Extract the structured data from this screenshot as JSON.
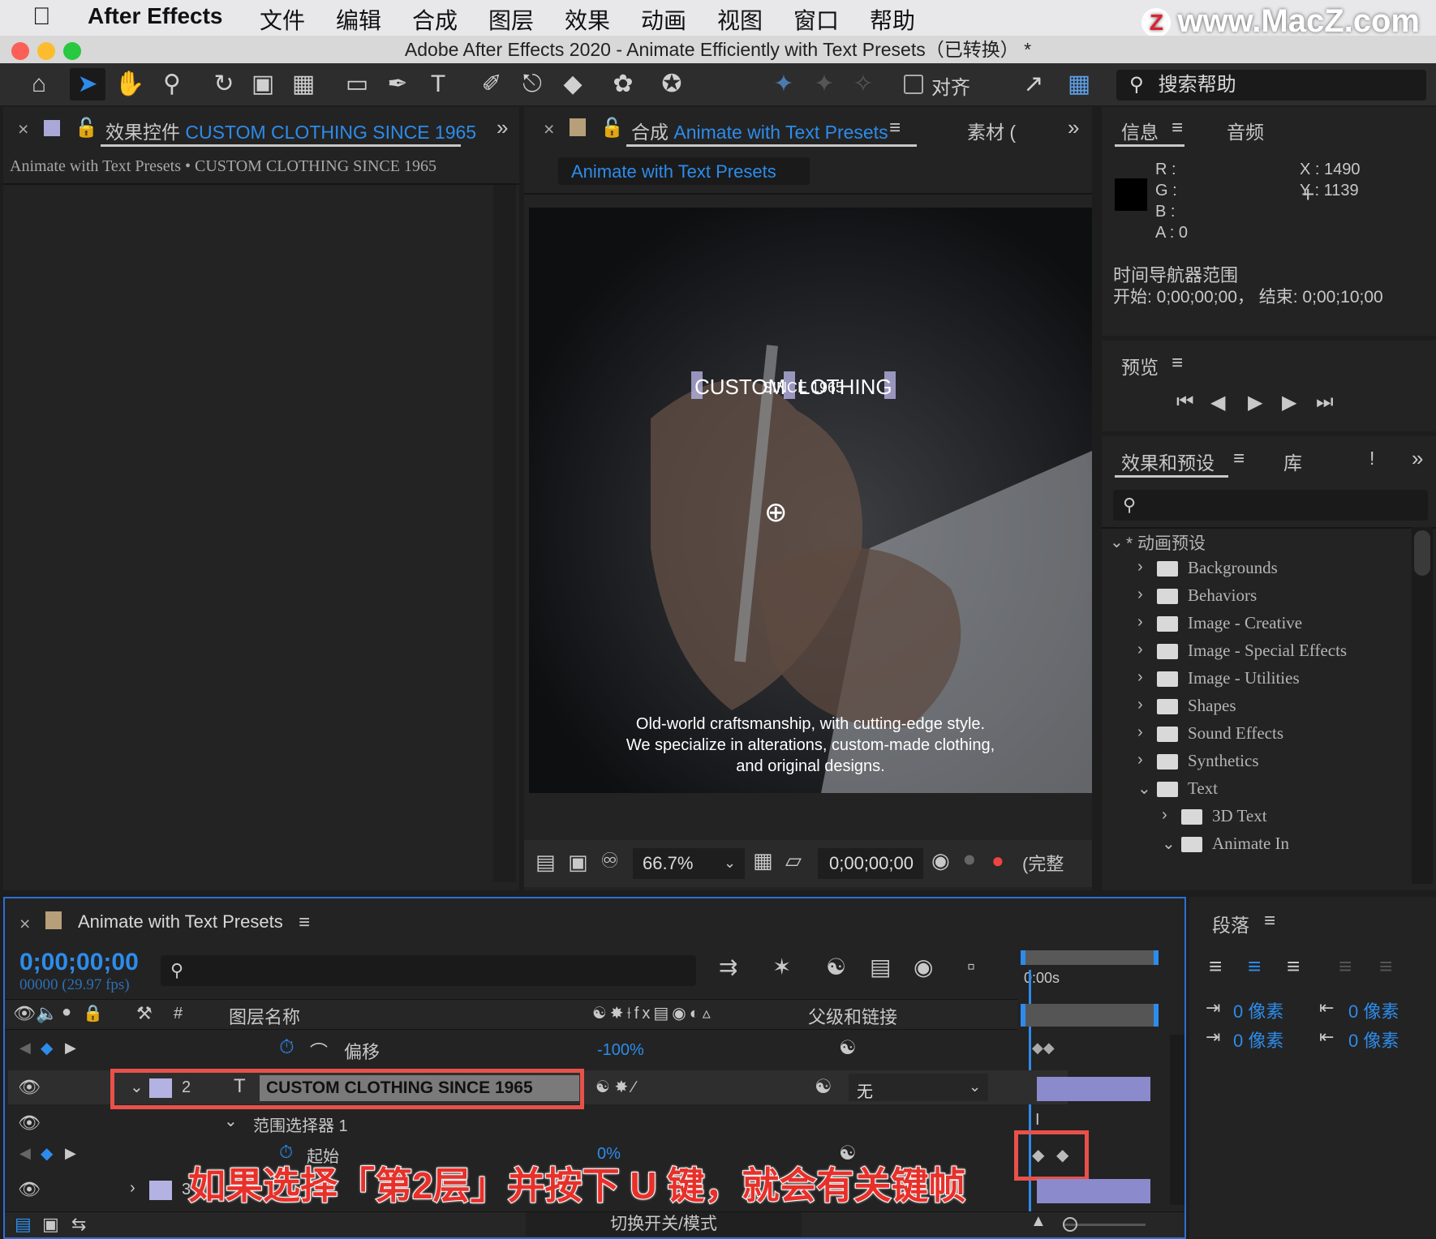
{
  "menubar": {
    "app": "After Effects",
    "items": [
      "文件",
      "编辑",
      "合成",
      "图层",
      "效果",
      "动画",
      "视图",
      "窗口",
      "帮助"
    ],
    "watermark": "www.MacZ.com",
    "watermark_logo": "Z"
  },
  "window": {
    "title": "Adobe After Effects 2020 - Animate Efficiently with Text Presets（已转换） *"
  },
  "toolbar": {
    "align_label": "对齐",
    "search_help": "搜索帮助"
  },
  "effects_panel": {
    "tab_prefix": "效果控件",
    "tab_layer": "CUSTOM CLOTHING  SINCE 1965",
    "breadcrumb": "Animate with Text Presets • CUSTOM CLOTHING  SINCE 1965"
  },
  "comp_panel": {
    "tab_prefix": "合成",
    "tab_comp": "Animate with Text Presets",
    "other_tab": "素材",
    "other_tab_paren": "(",
    "subtab": "Animate with Text Presets",
    "title_text_left": "CUSTOM",
    "title_text_mid": "SINCE 1965",
    "title_text_right": "LOTHING",
    "caption_line1": "Old-world craftsmanship, with cutting-edge style.",
    "caption_line2": "We specialize in alterations, custom-made clothing,",
    "caption_line3": "and original designs.",
    "zoom": "66.7%",
    "timecode": "0;00;00;00",
    "resolution": "(完整"
  },
  "info_panel": {
    "tab_info": "信息",
    "tab_audio": "音频",
    "r": "R :",
    "g": "G :",
    "b": "B :",
    "a": "A :  0",
    "x": "X : 1490",
    "y": "Y : 1139",
    "nav_title": "时间导航器范围",
    "nav_range": "开始: 0;00;00;00，  结束: 0;00;10;00"
  },
  "preview_panel": {
    "tab": "预览"
  },
  "effects_presets": {
    "tab": "效果和预设",
    "tab_lib": "库",
    "tab_more": "!",
    "root": "* 动画预设",
    "folders": [
      "Backgrounds",
      "Behaviors",
      "Image - Creative",
      "Image - Special Effects",
      "Image - Utilities",
      "Shapes",
      "Sound Effects",
      "Synthetics",
      "Text"
    ],
    "subfolders": [
      "3D Text",
      "Animate In"
    ]
  },
  "timeline": {
    "tab": "Animate with Text Presets",
    "timecode": "0;00;00;00",
    "frames": "00000 (29.97 fps)",
    "ruler_label": "0:00s",
    "col_number": "#",
    "col_layer_name": "图层名称",
    "col_parent": "父级和链接",
    "row_offset_label": "偏移",
    "row_offset_value": "-100%",
    "row_hidden_label": "范围选择器 1",
    "layer2_num": "2",
    "layer2_name": "CUSTOM CLOTHING  SINCE 1965",
    "layer2_parent": "无",
    "range_selector": "范围选择器 1",
    "start_label": "起始",
    "start_value": "0%",
    "layer3_num": "3",
    "toggle_label": "切换开关/模式"
  },
  "paragraph_panel": {
    "tab": "段落",
    "v1": "0 像素",
    "v2": "0 像素",
    "v3": "0 像素",
    "v4": "0 像素"
  },
  "annotation": "如果选择「第2层」并按下 U 键，就会有关键帧",
  "colors": {
    "accent_blue": "#2d8ceb",
    "highlight_red": "#e8514a",
    "annotation_text": "#e8302a"
  }
}
